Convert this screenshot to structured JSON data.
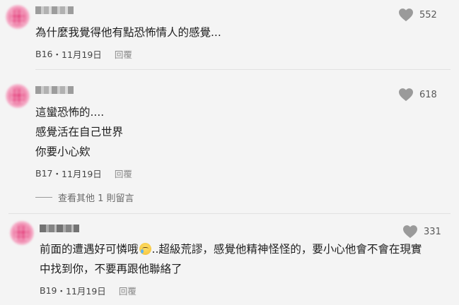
{
  "comments": [
    {
      "likes": "552",
      "lines": [
        "為什麼我覺得他有點恐怖情人的感覺..."
      ],
      "floor": "B16",
      "date": "11月19日",
      "reply_label": "回覆"
    },
    {
      "likes": "618",
      "lines": [
        "這蠻恐怖的....",
        "感覺活在自己世界",
        "你要小心欸"
      ],
      "floor": "B17",
      "date": "11月19日",
      "reply_label": "回覆",
      "view_more": "查看其他 1 則留言"
    },
    {
      "likes": "331",
      "line1_before": "前面的遭遇好可憐哦",
      "line1_after": "..超級荒謬，感覺他精神怪怪的，要小心他會不會在現實",
      "line2": "中找到你，不要再跟他聯絡了",
      "floor": "B19",
      "date": "11月19日",
      "reply_label": "回覆",
      "emoji": "crying-face-emoji"
    }
  ],
  "meta_separator": "・",
  "colors": {
    "background": "#f4f4f4",
    "avatar": "#e23a78",
    "heart": "#9a9a9a"
  }
}
